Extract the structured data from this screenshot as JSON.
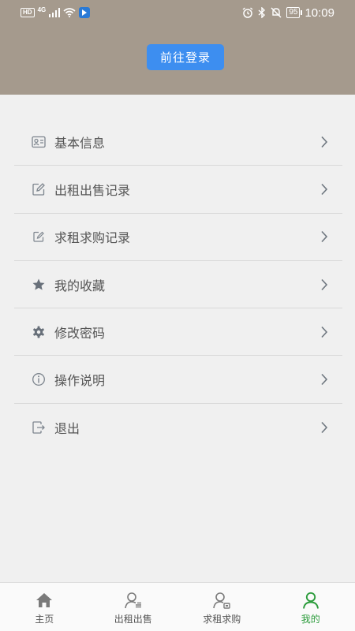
{
  "status_bar": {
    "hd": "HD",
    "net": "4G",
    "battery": "95",
    "time": "10:09"
  },
  "header": {
    "login_label": "前往登录"
  },
  "menu": {
    "items": [
      {
        "label": "基本信息",
        "icon": "id-card-icon"
      },
      {
        "label": "出租出售记录",
        "icon": "edit-icon"
      },
      {
        "label": "求租求购记录",
        "icon": "pencil-square-icon"
      },
      {
        "label": "我的收藏",
        "icon": "star-icon"
      },
      {
        "label": "修改密码",
        "icon": "gear-icon"
      },
      {
        "label": "操作说明",
        "icon": "info-icon"
      },
      {
        "label": "退出",
        "icon": "logout-icon"
      }
    ]
  },
  "tabbar": {
    "tabs": [
      {
        "label": "主页",
        "icon": "home-icon",
        "active": false
      },
      {
        "label": "出租出售",
        "icon": "user-list-icon",
        "active": false
      },
      {
        "label": "求租求购",
        "icon": "user-card-icon",
        "active": false
      },
      {
        "label": "我的",
        "icon": "user-icon",
        "active": true
      }
    ],
    "active_color": "#2c9c3c",
    "inactive_color": "#777777"
  },
  "colors": {
    "header_bg": "#a59a8d",
    "login_button": "#3d8ef0",
    "page_bg": "#f0f0f0"
  }
}
